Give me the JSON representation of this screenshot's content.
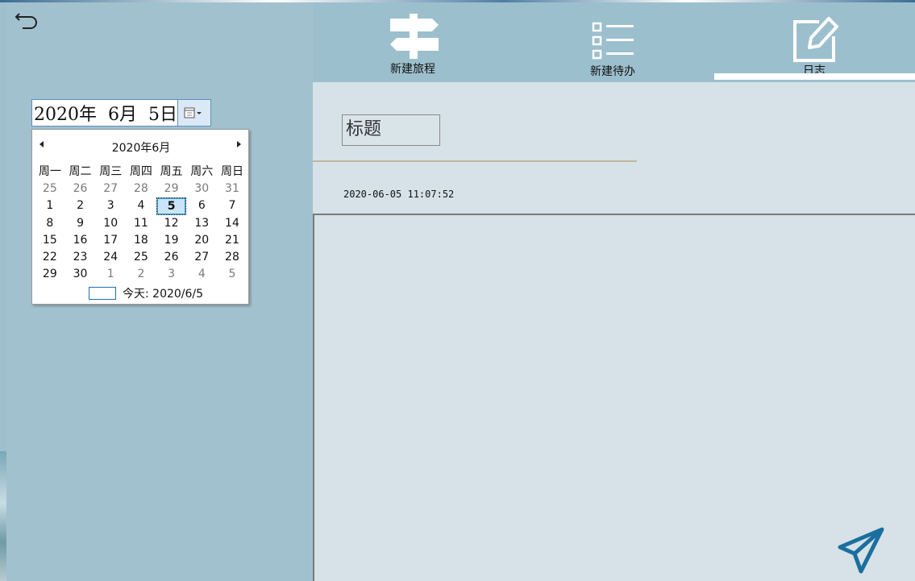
{
  "left": {
    "date_picker": {
      "value": "2020年  6月  5日"
    },
    "calendar": {
      "title": "2020年6月",
      "weekdays": [
        "周一",
        "周二",
        "周三",
        "周四",
        "周五",
        "周六",
        "周日"
      ],
      "weeks": [
        [
          "25",
          "26",
          "27",
          "28",
          "29",
          "30",
          "31"
        ],
        [
          "1",
          "2",
          "3",
          "4",
          "5",
          "6",
          "7"
        ],
        [
          "8",
          "9",
          "10",
          "11",
          "12",
          "13",
          "14"
        ],
        [
          "15",
          "16",
          "17",
          "18",
          "19",
          "20",
          "21"
        ],
        [
          "22",
          "23",
          "24",
          "25",
          "26",
          "27",
          "28"
        ],
        [
          "29",
          "30",
          "1",
          "2",
          "3",
          "4",
          "5"
        ]
      ],
      "selected_day": "5",
      "today_label": "今天: 2020/6/5"
    }
  },
  "toolbar": {
    "new_trip_label": "新建旅程",
    "new_todo_label": "新建待办",
    "journal_label": "日志"
  },
  "editor": {
    "title_placeholder": "标题",
    "timestamp": "2020-06-05 11:07:52"
  },
  "colors": {
    "send_icon": "#1a6f9e",
    "accent": "#26a0da"
  }
}
